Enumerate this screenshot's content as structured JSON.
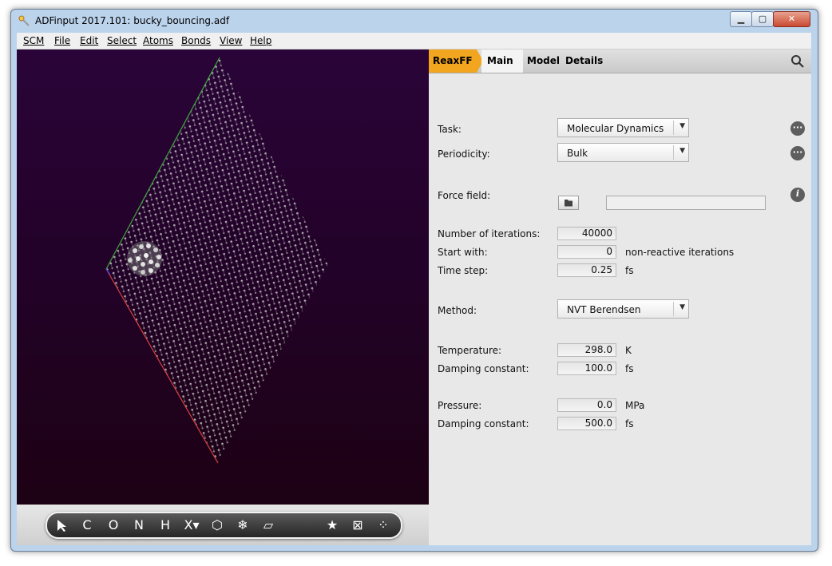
{
  "window": {
    "title": "ADFinput 2017.101: bucky_bouncing.adf",
    "minimize_label": "▁",
    "maximize_label": "▢",
    "close_label": "✕"
  },
  "menu": [
    "SCM",
    "File",
    "Edit",
    "Select",
    "Atoms",
    "Bonds",
    "View",
    "Help"
  ],
  "toolbar": {
    "tools": [
      {
        "name": "select-arrow-tool",
        "label": ""
      },
      {
        "name": "carbon-tool",
        "label": "C"
      },
      {
        "name": "oxygen-tool",
        "label": "O"
      },
      {
        "name": "nitrogen-tool",
        "label": "N"
      },
      {
        "name": "hydrogen-tool",
        "label": "H"
      },
      {
        "name": "other-element-tool",
        "label": "X▾"
      },
      {
        "name": "ring-tool",
        "label": "⬡"
      },
      {
        "name": "structures-tool",
        "label": "❄"
      },
      {
        "name": "plane-tool",
        "label": "▱"
      },
      {
        "name": "favorites-tool",
        "label": "★"
      },
      {
        "name": "crystal-tool",
        "label": "⊠"
      },
      {
        "name": "more-tools",
        "label": "⁘"
      }
    ]
  },
  "tabs": {
    "reaxff": "ReaxFF",
    "main": "Main",
    "model": "Model",
    "details": "Details"
  },
  "colors": {
    "accent": "#f2a51e",
    "viewer_top": "#2a0438",
    "viewer_bottom": "#1c0110",
    "axis_x": "#d84040",
    "axis_y": "#3fa63f"
  },
  "form": {
    "task_label": "Task:",
    "task_value": "Molecular Dynamics",
    "periodicity_label": "Periodicity:",
    "periodicity_value": "Bulk",
    "forcefield_label": "Force field:",
    "forcefield_value": "",
    "iterations_label": "Number of iterations:",
    "iterations_value": "40000",
    "startwith_label": "Start with:",
    "startwith_value": "0",
    "startwith_unit": "non-reactive iterations",
    "timestep_label": "Time step:",
    "timestep_value": "0.25",
    "timestep_unit": "fs",
    "method_label": "Method:",
    "method_value": "NVT Berendsen",
    "temperature_label": "Temperature:",
    "temperature_value": "298.0",
    "temperature_unit": "K",
    "tdamping_label": "Damping constant:",
    "tdamping_value": "100.0",
    "tdamping_unit": "fs",
    "pressure_label": "Pressure:",
    "pressure_value": "0.0",
    "pressure_unit": "MPa",
    "pdamping_label": "Damping constant:",
    "pdamping_value": "500.0",
    "pdamping_unit": "fs",
    "more_label": "···",
    "info_label": "i"
  }
}
